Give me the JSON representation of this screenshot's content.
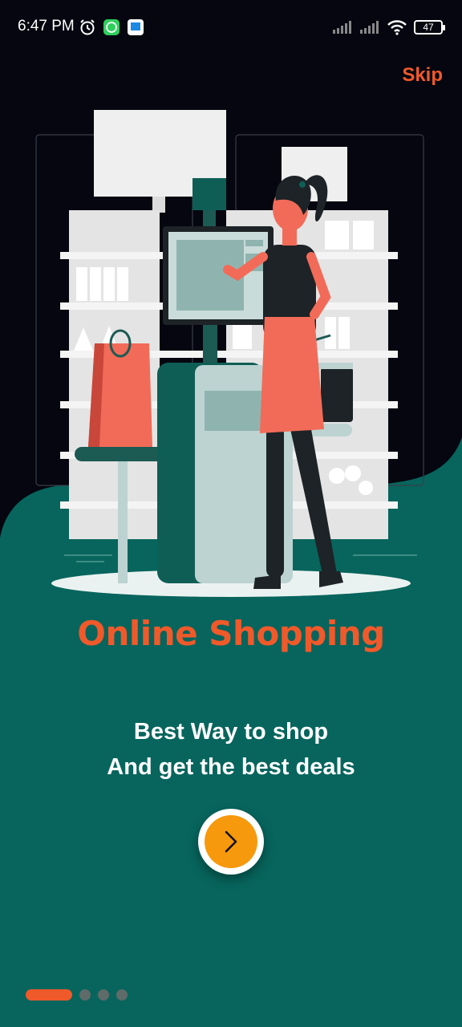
{
  "status_bar": {
    "time": "6:47 PM",
    "battery": "47",
    "left_icons": [
      "alarm-icon",
      "whatsapp-icon",
      "app-notification-icon"
    ],
    "right_icons": [
      "signal-icon",
      "signal-icon",
      "wifi-icon",
      "battery-icon"
    ]
  },
  "onboarding": {
    "skip_label": "Skip",
    "title": "Online Shopping",
    "subtitle_line1": "Best Way to shop",
    "subtitle_line2": "And get the best deals",
    "next_icon": "chevron-right-icon",
    "page_count": 4,
    "current_page": 1
  },
  "colors": {
    "background_dark": "#05060f",
    "background_teal": "#07655d",
    "accent_orange": "#f0592a",
    "button_orange": "#f7990c",
    "text_white": "#ffffff"
  }
}
